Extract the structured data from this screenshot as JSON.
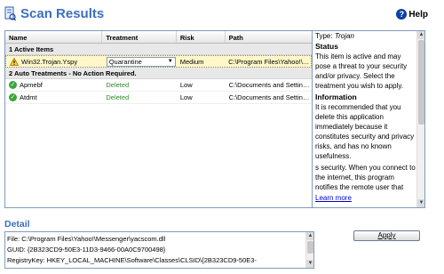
{
  "header": {
    "title": "Scan Results",
    "help_label": "Help",
    "help_glyph": "?"
  },
  "grid": {
    "columns": [
      "Name",
      "Treatment",
      "Risk",
      "Path"
    ],
    "groups": [
      {
        "title": "1 Active Items",
        "rows": [
          {
            "icon": "warning-icon",
            "name": "Win32.Trojan.Yspy",
            "treatment": "Quarantine",
            "risk": "Medium",
            "path": "C:\\Program Files\\Yahoo!\\Me..."
          }
        ]
      },
      {
        "title": "2 Auto Treatments - No Action Required.",
        "rows": [
          {
            "icon": "check-icon",
            "name": "Apmebf",
            "treatment": "Deleted",
            "risk": "Low",
            "path": "C:\\Documents and Settings\\..."
          },
          {
            "icon": "check-icon",
            "name": "Atdmt",
            "treatment": "Deleted",
            "risk": "Low",
            "path": "C:\\Documents and Settings\\..."
          }
        ]
      }
    ]
  },
  "info": {
    "type_label": "Type:",
    "type_value": "Trojan",
    "status_heading": "Status",
    "status_text": "This item is active and may pose a threat to your security and/or privacy. Select the treatment you wish to apply.",
    "info_heading": "Information",
    "info_text": "It is recommended that you delete this application immediately because it constitutes security and privacy risks, and has no known usefulness.",
    "info_text2": "s security. When you connect to the internet, this program notifies the remote user that",
    "learn_more": "Learn more"
  },
  "detail": {
    "title": "Detail",
    "lines": [
      "File: C:\\Program Files\\Yahoo!\\Messenger\\yacscom.dll",
      "GUID: {2B323CD9-50E3-11D3-9466-00A0C9700498}",
      "RegistryKey: HKEY_LOCAL_MACHINE\\Software\\Classes\\CLSID\\{2B323CD9-50E3-"
    ]
  },
  "actions": {
    "apply_label": "Apply"
  },
  "colors": {
    "title_blue": "#3a6fc0",
    "deleted_green": "#2c8a2c",
    "selected_row": "#fff7c8"
  }
}
